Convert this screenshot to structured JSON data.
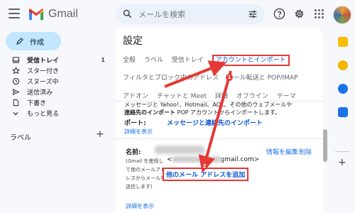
{
  "app": {
    "name": "Gmail"
  },
  "search": {
    "placeholder": "メールを検索"
  },
  "compose": {
    "label": "作成"
  },
  "nav": [
    {
      "label": "受信トレイ",
      "count": "1",
      "icon": "inbox-icon",
      "bold": true
    },
    {
      "label": "スター付き",
      "icon": "star-icon"
    },
    {
      "label": "スヌーズ中",
      "icon": "clock-icon"
    },
    {
      "label": "送信済み",
      "icon": "send-icon"
    },
    {
      "label": "下書き",
      "icon": "draft-icon"
    },
    {
      "label": "もっと見る",
      "icon": "chevron-down-icon"
    }
  ],
  "labels": {
    "heading": "ラベル",
    "add": "+"
  },
  "settings": {
    "title": "設定",
    "tabs_row1": [
      "全般",
      "ラベル",
      "受信トレイ",
      "アカウントとインポート"
    ],
    "tabs_row2": [
      "フィルタとブロック中のアドレス",
      "メール転送と POP/IMAP"
    ],
    "tabs_row3": [
      "アドオン",
      "チャットと Meet",
      "詳細",
      "オフライン",
      "テーマ"
    ],
    "active_tab": "アカウントとインポート",
    "import": {
      "text_line1": "メッセージと Yahoo!、Hotmail、AOL、その他のウェブメールや",
      "text_line2_bold": "連絡先のインポート",
      "text_line2": "POP アカウントからインポートします。",
      "label": "ポート:",
      "link": "メッセージと連絡先のインポート",
      "detail": "詳細を表示"
    },
    "sendas": {
      "label": "名前:",
      "desc": "(Gmail を使用して他のメールアドレスからメールを送信します)",
      "email_prefix": "<",
      "email_suffix": "gmail.com>",
      "info_link": "情報を編集",
      "delete_link": "削除",
      "add_button": "他のメール アドレスを追加",
      "detail": "詳細を表示"
    }
  },
  "annotations": {
    "badge1": "1",
    "badge2": "2",
    "color": "#e53935"
  }
}
